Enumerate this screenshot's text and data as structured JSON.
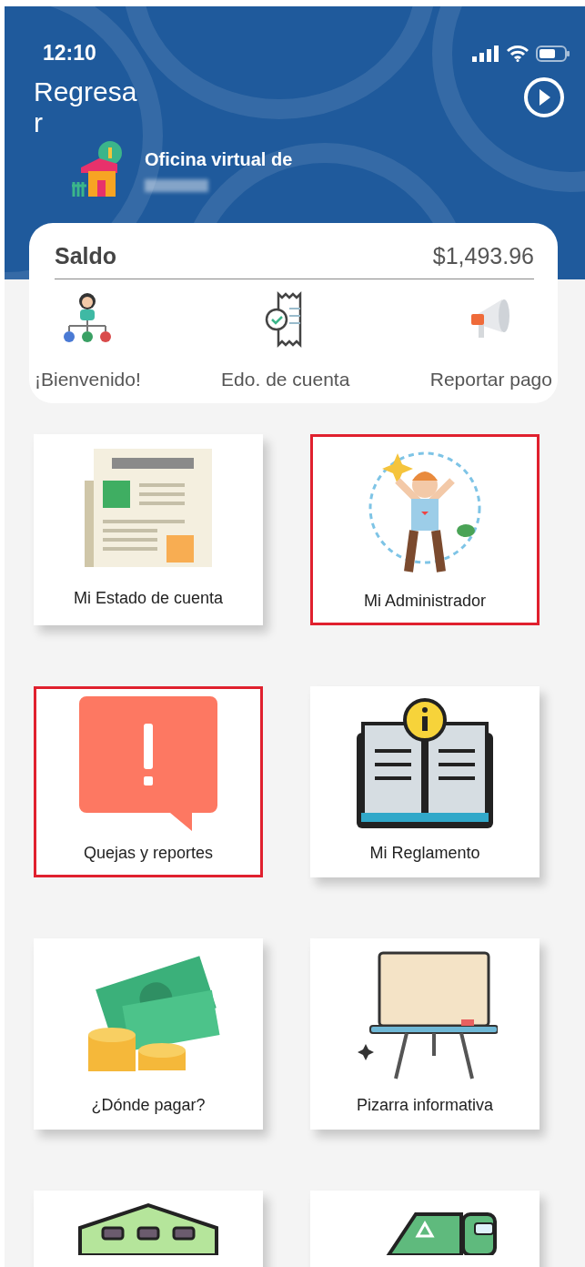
{
  "status_bar": {
    "time": "12:10"
  },
  "header": {
    "back": "Regresa r",
    "title": "Oficina virtual de"
  },
  "balance_card": {
    "label": "Saldo",
    "amount": "$1,493.96",
    "actions": [
      {
        "label": "¡Bienvenido!"
      },
      {
        "label": "Edo. de cuenta"
      },
      {
        "label": "Reportar pago"
      }
    ]
  },
  "tiles": [
    {
      "label": "Mi Estado de cuenta",
      "highlighted": false
    },
    {
      "label": "Mi Administrador",
      "highlighted": true
    },
    {
      "label": "Quejas y reportes",
      "highlighted": true
    },
    {
      "label": "Mi Reglamento",
      "highlighted": false
    },
    {
      "label": "¿Dónde pagar?",
      "highlighted": false
    },
    {
      "label": "Pizarra informativa",
      "highlighted": false
    },
    {
      "highlighted": false
    },
    {
      "highlighted": false
    }
  ]
}
